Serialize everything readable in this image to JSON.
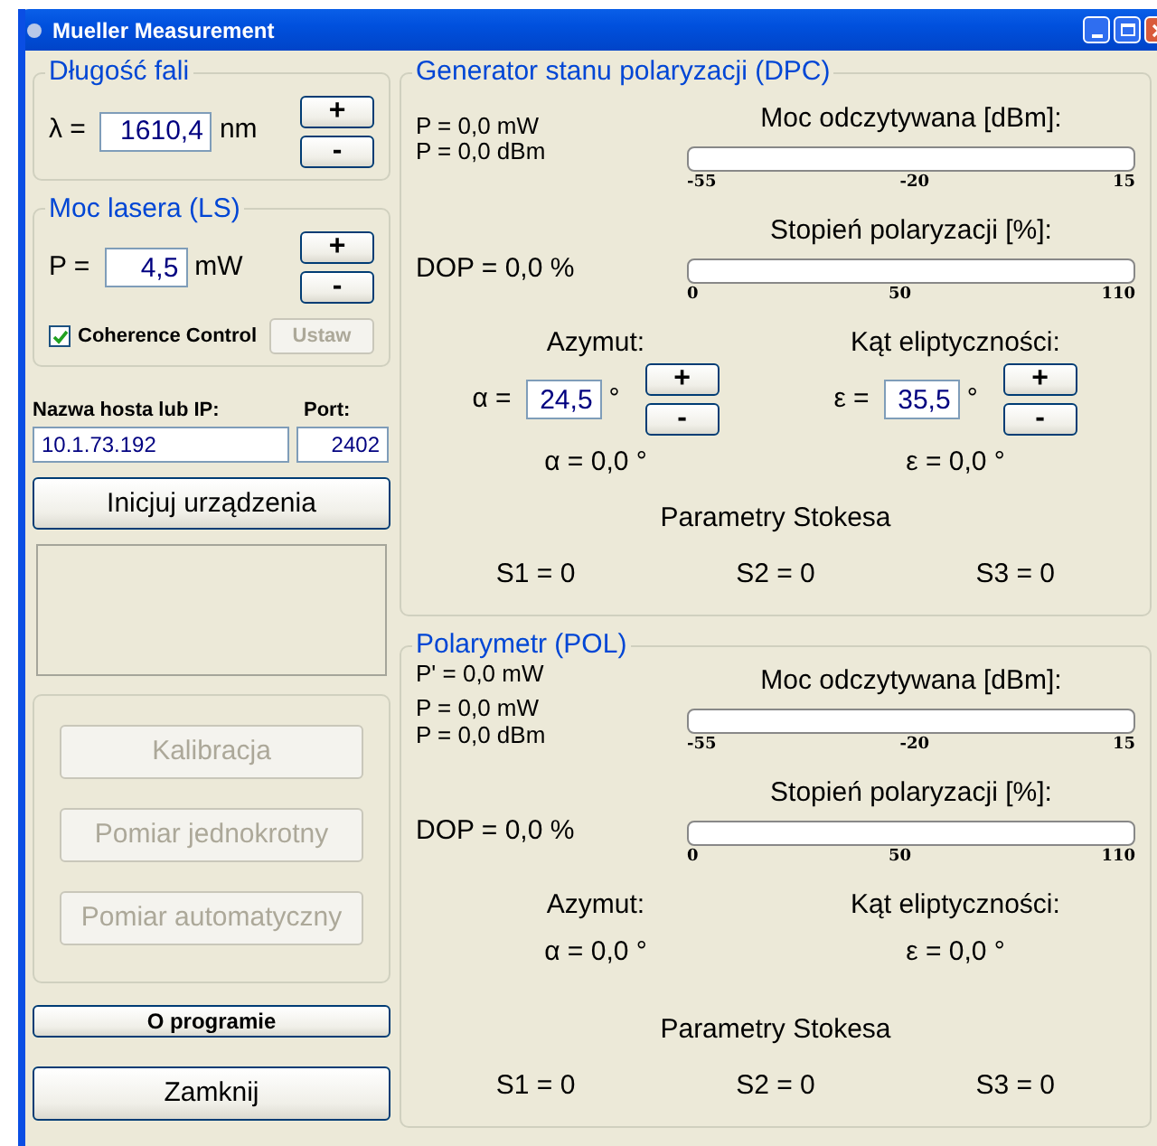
{
  "window": {
    "title": "Mueller Measurement"
  },
  "wavelength": {
    "title": "Długość fali",
    "symbol": "λ =",
    "value": "1610,4",
    "unit": "nm",
    "buttons": [
      "+",
      "-"
    ]
  },
  "laser_power": {
    "title": "Moc lasera (LS)",
    "symbol": "P =",
    "value": "4,5",
    "unit": "mW",
    "buttons": [
      "+",
      "-"
    ],
    "coherence": {
      "label": "Coherence Control",
      "checked": true
    },
    "apply_button": {
      "label": "Ustaw",
      "disabled": true
    }
  },
  "connection": {
    "host_label": "Nazwa hosta lub IP:",
    "host_value": "10.1.73.192",
    "port_label": "Port:",
    "port_value": "2402"
  },
  "init_button": "Inicjuj urządzenia",
  "measurement_buttons": [
    {
      "label": "Kalibracja",
      "disabled": true
    },
    {
      "label": "Pomiar jednokrotny",
      "disabled": true
    },
    {
      "label": "Pomiar automatyczny",
      "disabled": true
    }
  ],
  "about_button": "O programie",
  "close_button": "Zamknij",
  "generator": {
    "title": "Generator stanu polaryzacji (DPC)",
    "readings": [
      "P = 0,0 mW",
      "P = 0,0 dBm"
    ],
    "dop": "DOP = 0,0 %",
    "meters": [
      {
        "title": "Moc odczytywana [dBm]:",
        "level": 0,
        "ticks": [
          "-55",
          "-20",
          "15"
        ]
      },
      {
        "title": "Stopień polaryzacji [%]:",
        "level": 0,
        "ticks": [
          "0",
          "50",
          "110"
        ]
      }
    ],
    "angles": [
      {
        "label": "Azymut:",
        "symbol": "α =",
        "value": "24,5",
        "unit": "°",
        "buttons": [
          "+",
          "-"
        ],
        "reading": "α = 0,0 °"
      },
      {
        "label": "Kąt eliptyczności:",
        "symbol": "ε =",
        "value": "35,5",
        "unit": "°",
        "buttons": [
          "+",
          "-"
        ],
        "reading": "ε = 0,0 °"
      }
    ],
    "stokes": {
      "title": "Parametry Stokesa",
      "values": [
        "S1 = 0",
        "S2 = 0",
        "S3 = 0"
      ]
    }
  },
  "polarimeter": {
    "title": "Polarymetr (POL)",
    "readings": [
      "P' = 0,0 mW",
      "P = 0,0 mW",
      "P = 0,0 dBm"
    ],
    "dop": "DOP = 0,0 %",
    "meters": [
      {
        "title": "Moc odczytywana [dBm]:",
        "level": 0,
        "ticks": [
          "-55",
          "-20",
          "15"
        ]
      },
      {
        "title": "Stopień polaryzacji [%]:",
        "level": 0,
        "ticks": [
          "0",
          "50",
          "110"
        ]
      }
    ],
    "angles": [
      {
        "label": "Azymut:",
        "reading": "α = 0,0 °"
      },
      {
        "label": "Kąt eliptyczności:",
        "reading": "ε = 0,0 °"
      }
    ],
    "stokes": {
      "title": "Parametry Stokesa",
      "values": [
        "S1 = 0",
        "S2 = 0",
        "S3 = 0"
      ]
    }
  }
}
